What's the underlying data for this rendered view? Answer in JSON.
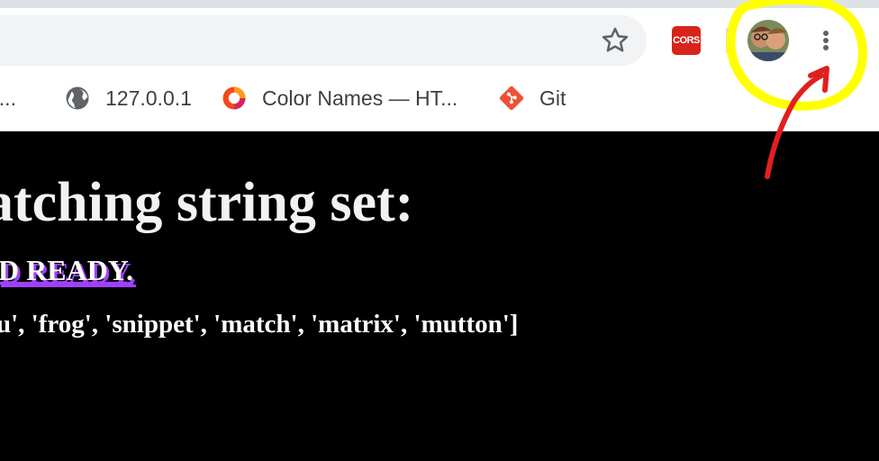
{
  "toolbar": {
    "extension_cors_label": "CORS",
    "menu_icon": "vertical-ellipsis-icon",
    "bookmark_star_icon": "star-icon"
  },
  "bookmarks": [
    {
      "label": "o...",
      "icon": "truncated-bookmark"
    },
    {
      "label": "127.0.0.1",
      "icon": "globe-icon"
    },
    {
      "label": "Color Names — HT...",
      "icon": "color-ring-icon"
    },
    {
      "label": "Git",
      "icon": "git-icon"
    }
  ],
  "page": {
    "heading": "atching string set:",
    "status": "D READY.",
    "list_text": "u', 'frog', 'snippet', 'match', 'matrix', 'mutton']"
  },
  "colors": {
    "page_background": "#000000",
    "heading_text": "#f2f2f2",
    "status_shadow": "#a040ff",
    "annotation_highlight": "#ffff00",
    "annotation_arrow": "#e02020"
  }
}
